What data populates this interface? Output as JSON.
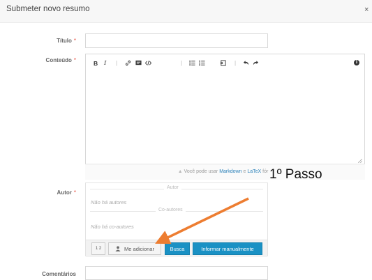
{
  "dialog": {
    "title": "Submeter novo resumo",
    "close_symbol": "×"
  },
  "fields": {
    "title_label": "Título",
    "content_label": "Conteúdo",
    "author_label": "Autor",
    "comments_label": "Comentários",
    "required_marker": "*"
  },
  "editor": {
    "toolbar": {
      "bold": "B",
      "italic": "I",
      "sep": "|",
      "link_icon": "link-icon",
      "image_icon": "image-icon",
      "code_icon": "code-icon",
      "ordered_list_icon": "ordered-list-icon",
      "unordered_list_icon": "unordered-list-icon",
      "fullscreen_icon": "fullscreen-icon",
      "undo_icon": "undo-icon",
      "redo_icon": "redo-icon",
      "info_icon": "info-icon",
      "info_text": "i"
    },
    "hint_prefix": "Você pode usar",
    "hint_markdown": "Markdown",
    "hint_and": "e",
    "hint_latex": "LaTeX",
    "hint_suffix": "fór"
  },
  "authors": {
    "author_divider": "Autor",
    "no_authors": "Não há autores",
    "coauthors_divider": "Co-autores",
    "no_coauthors": "Não há co-autores",
    "sort_label": "1 2",
    "add_me": "Me adicionar",
    "search": "Busca",
    "manual": "Informar manualmente"
  },
  "annotation": {
    "text": "1º Passo",
    "arrow_color": "#ed7d31"
  },
  "colors": {
    "accent_blue": "#1a91c4",
    "required_red": "#e74c3c"
  }
}
